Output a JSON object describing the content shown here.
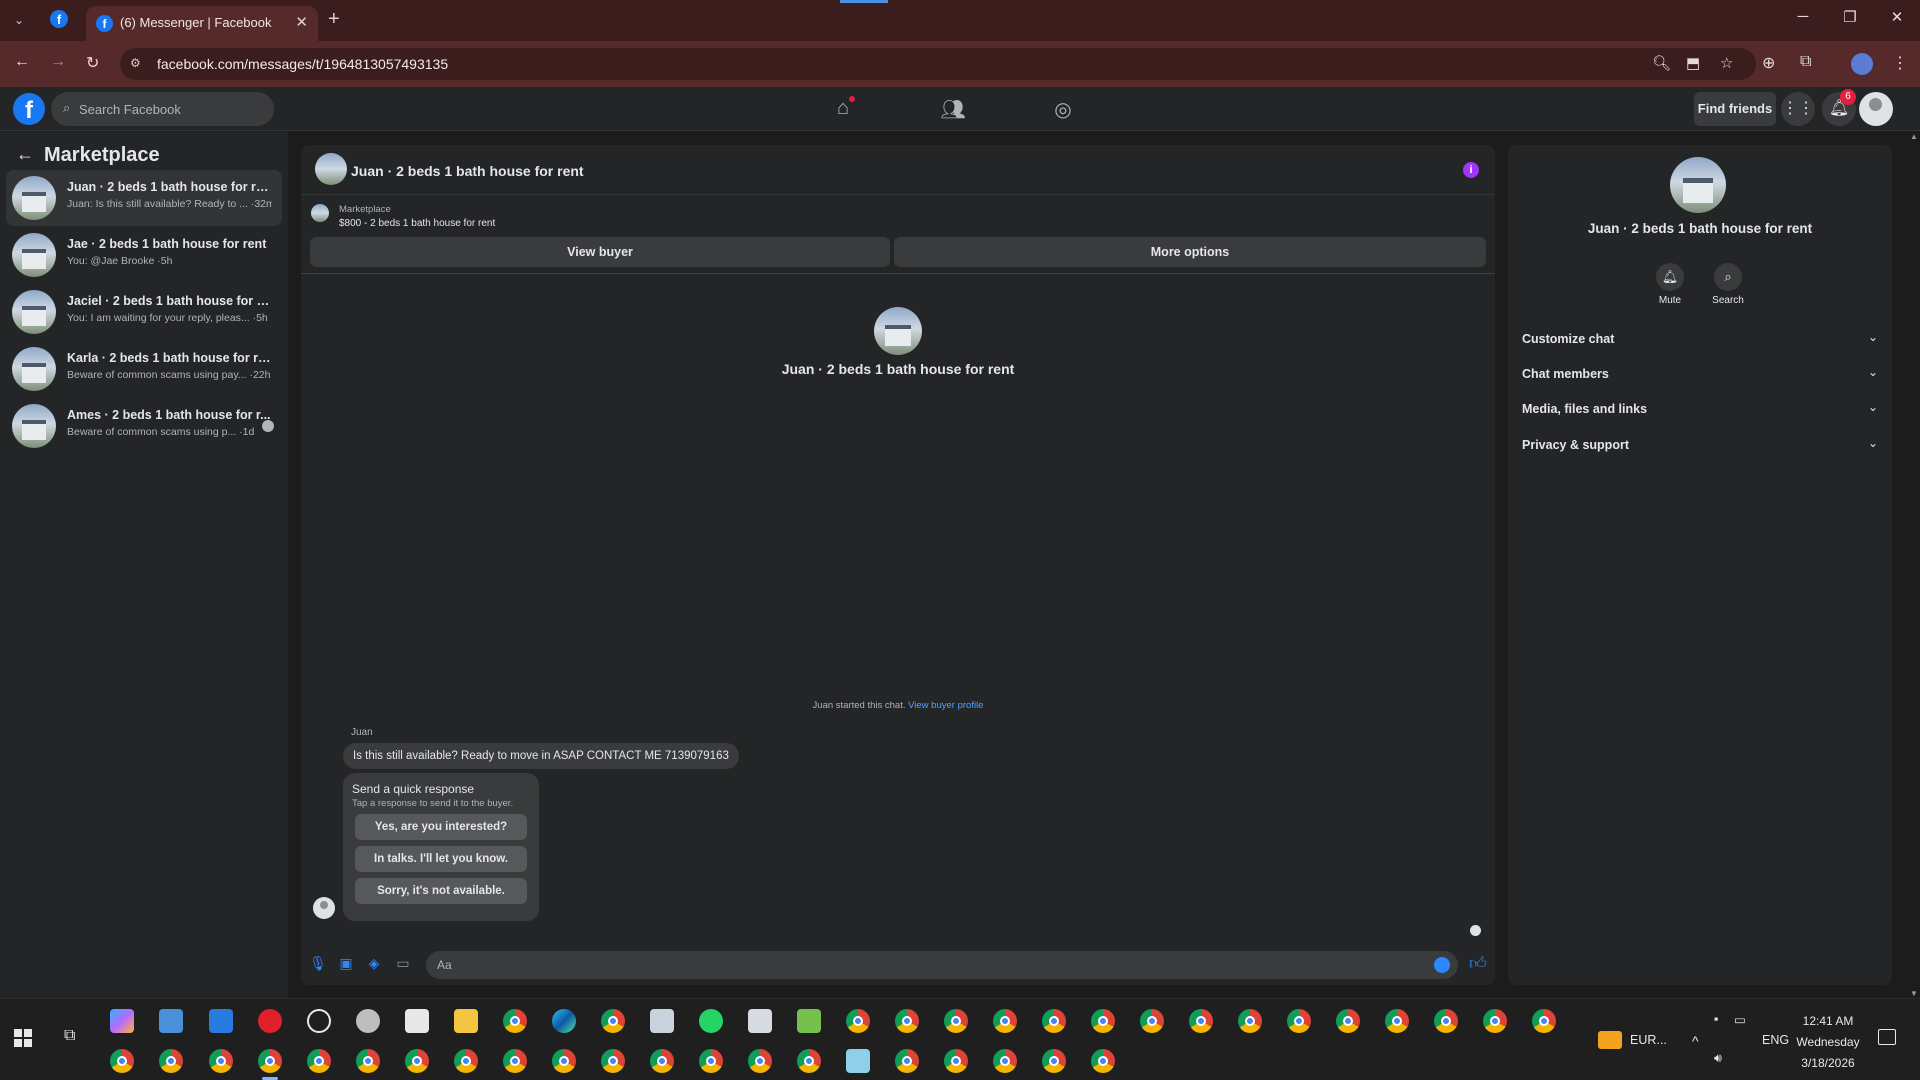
{
  "browser": {
    "tab_title": "(6) Messenger | Facebook",
    "url": "facebook.com/messages/t/1964813057493135",
    "new_tab": "+",
    "close": "✕"
  },
  "fb": {
    "search_placeholder": "Search Facebook",
    "find_friends": "Find friends",
    "notification_count": "6"
  },
  "sidebar": {
    "title": "Marketplace",
    "conversations": [
      {
        "name": "Juan · 2 beds 1 bath house for rent",
        "preview": "Juan: Is this still available? Ready to ... ·32m"
      },
      {
        "name": "Jae · 2 beds 1 bath house for rent",
        "preview": "You: @Jae Brooke ·5h"
      },
      {
        "name": "Jaciel · 2 beds 1 bath house for rent",
        "preview": "You: I am waiting for your reply, pleas... ·5h"
      },
      {
        "name": "Karla · 2 beds 1 bath house for rent",
        "preview": "Beware of common scams using pay... ·22h"
      },
      {
        "name": "Ames · 2 beds 1 bath house for r...",
        "preview": "Beware of common scams using p... ·1d"
      }
    ]
  },
  "chat": {
    "title": "Juan · 2 beds 1 bath house for rent",
    "listing_source": "Marketplace",
    "listing_price": "$800 - 2 beds 1 bath house for rent",
    "view_buyer": "View buyer",
    "more_options": "More options",
    "center_name": "Juan · 2 beds 1 bath house for rent",
    "started_text": "Juan started this chat.",
    "view_buyer_profile": "View buyer profile",
    "sender": "Juan",
    "message": "Is this still available? Ready to move in ASAP CONTACT ME 7139079163",
    "quick_title": "Send a quick response",
    "quick_subtitle": "Tap a response to send it to the buyer.",
    "quick_replies": [
      "Yes, are you interested?",
      "In talks. I'll let you know.",
      "Sorry, it's not available."
    ],
    "composer_placeholder": "Aa"
  },
  "info": {
    "name": "Juan · 2 beds 1 bath house for rent",
    "mute": "Mute",
    "search": "Search",
    "sections": [
      "Customize chat",
      "Chat members",
      "Media, files and links",
      "Privacy & support"
    ]
  },
  "taskbar": {
    "tray_app_label": "EUR...",
    "language": "ENG",
    "time": "12:41 AM",
    "day": "Wednesday",
    "date": "3/18/2026"
  },
  "colors": {
    "accent": "#1877f2",
    "messenger_blue": "#2d88ff",
    "info_purple": "#a334fa",
    "chrome_frame": "#3c1d1d"
  }
}
